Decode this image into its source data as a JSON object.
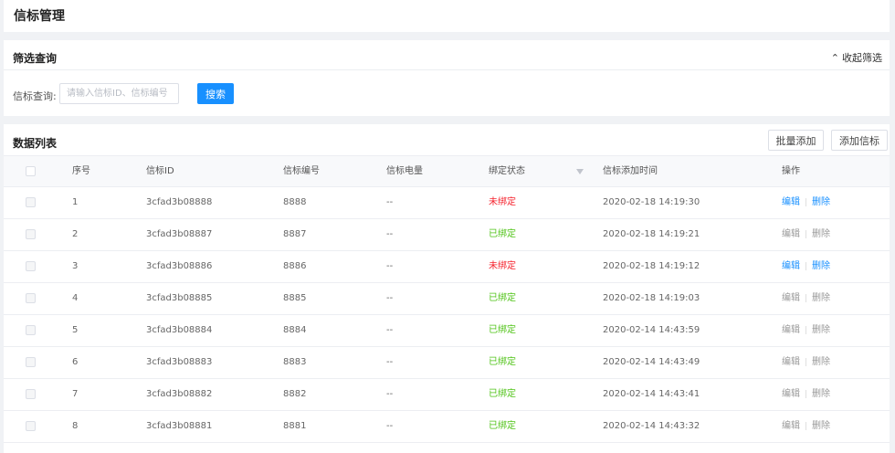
{
  "page": {
    "title": "信标管理"
  },
  "filter": {
    "title": "筛选查询",
    "collapse_label": "收起筛选",
    "collapse_icon": "double-chevron-up-icon",
    "query_label": "信标查询:",
    "query_placeholder": "请输入信标ID、信标编号",
    "query_value": "",
    "search_label": "搜索"
  },
  "list": {
    "title": "数据列表",
    "batch_add_label": "批量添加",
    "add_label": "添加信标",
    "columns": [
      "序号",
      "信标ID",
      "信标编号",
      "信标电量",
      "绑定状态",
      "信标添加时间",
      "操作"
    ],
    "rows": [
      {
        "idx": "1",
        "id": "3cfad3b08888",
        "num": "8888",
        "power": "--",
        "status": "未绑定",
        "bound": false,
        "time": "2020-02-18 14:19:30",
        "edit": "编辑",
        "del": "删除"
      },
      {
        "idx": "2",
        "id": "3cfad3b08887",
        "num": "8887",
        "power": "--",
        "status": "已绑定",
        "bound": true,
        "time": "2020-02-18 14:19:21",
        "edit": "编辑",
        "del": "删除"
      },
      {
        "idx": "3",
        "id": "3cfad3b08886",
        "num": "8886",
        "power": "--",
        "status": "未绑定",
        "bound": false,
        "time": "2020-02-18 14:19:12",
        "edit": "编辑",
        "del": "删除"
      },
      {
        "idx": "4",
        "id": "3cfad3b08885",
        "num": "8885",
        "power": "--",
        "status": "已绑定",
        "bound": true,
        "time": "2020-02-18 14:19:03",
        "edit": "编辑",
        "del": "删除"
      },
      {
        "idx": "5",
        "id": "3cfad3b08884",
        "num": "8884",
        "power": "--",
        "status": "已绑定",
        "bound": true,
        "time": "2020-02-14 14:43:59",
        "edit": "编辑",
        "del": "删除"
      },
      {
        "idx": "6",
        "id": "3cfad3b08883",
        "num": "8883",
        "power": "--",
        "status": "已绑定",
        "bound": true,
        "time": "2020-02-14 14:43:49",
        "edit": "编辑",
        "del": "删除"
      },
      {
        "idx": "7",
        "id": "3cfad3b08882",
        "num": "8882",
        "power": "--",
        "status": "已绑定",
        "bound": true,
        "time": "2020-02-14 14:43:41",
        "edit": "编辑",
        "del": "删除"
      },
      {
        "idx": "8",
        "id": "3cfad3b08881",
        "num": "8881",
        "power": "--",
        "status": "已绑定",
        "bound": true,
        "time": "2020-02-14 14:43:32",
        "edit": "编辑",
        "del": "删除"
      }
    ]
  },
  "colors": {
    "primary": "#1890ff",
    "unbound": "#f5222d",
    "bound": "#52c41a"
  }
}
